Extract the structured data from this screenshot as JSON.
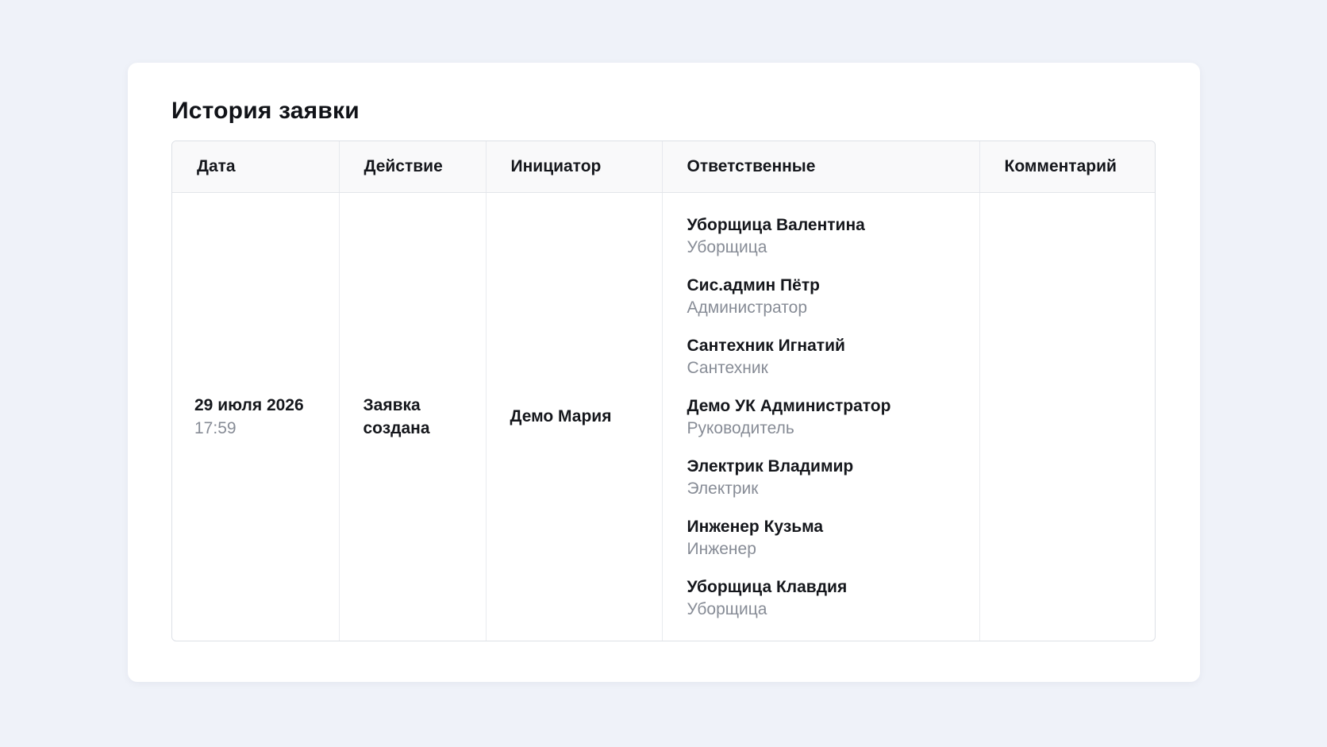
{
  "card": {
    "title": "История заявки"
  },
  "table": {
    "headers": {
      "date": "Дата",
      "action": "Действие",
      "initiator": "Инициатор",
      "responsible": "Ответственные",
      "comment": "Комментарий"
    },
    "rows": [
      {
        "date": "29 июля 2026",
        "time": "17:59",
        "action_line1": "Заявка",
        "action_line2": "создана",
        "initiator": "Демо Мария",
        "responsible": [
          {
            "name": "Уборщица Валентина",
            "role": "Уборщица"
          },
          {
            "name": "Сис.админ Пётр",
            "role": "Администратор"
          },
          {
            "name": "Сантехник Игнатий",
            "role": "Сантехник"
          },
          {
            "name": "Демо УК Администратор",
            "role": "Руководитель"
          },
          {
            "name": "Электрик Владимир",
            "role": "Электрик"
          },
          {
            "name": "Инженер Кузьма",
            "role": "Инженер"
          },
          {
            "name": "Уборщица Клавдия",
            "role": "Уборщица"
          }
        ],
        "comment": ""
      }
    ]
  }
}
